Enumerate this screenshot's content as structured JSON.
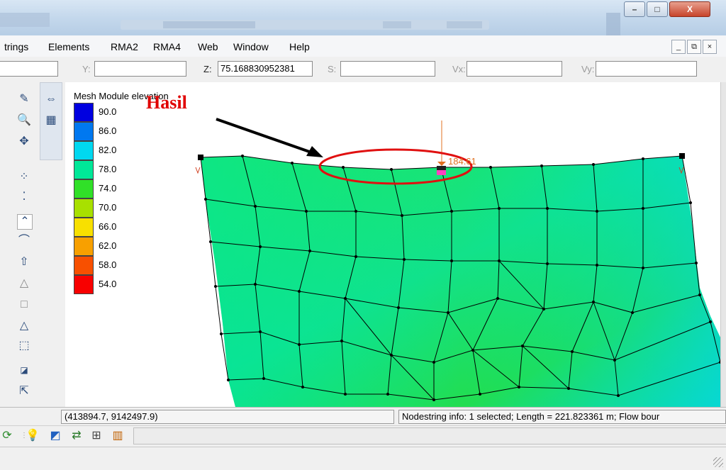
{
  "titlebar": {
    "minimize_label": "–",
    "maximize_label": "□",
    "close_label": "X"
  },
  "menu": {
    "items": [
      "trings",
      "Elements",
      "RMA2",
      "RMA4",
      "Web",
      "Window",
      "Help"
    ],
    "mdi_minimize": "_",
    "mdi_restore": "⧉",
    "mdi_close": "×"
  },
  "coords": {
    "y_label": "Y:",
    "y_value": "",
    "z_label": "Z:",
    "z_value": "75.168830952381",
    "s_label": "S:",
    "s_value": "",
    "vx_label": "Vx:",
    "vx_value": "",
    "vy_label": "Vy:",
    "vy_value": ""
  },
  "legend": {
    "title": "Mesh Module elevation",
    "entries": [
      {
        "value": "90.0",
        "color": "#0000e0"
      },
      {
        "value": "86.0",
        "color": "#0078f0"
      },
      {
        "value": "82.0",
        "color": "#00d8f0"
      },
      {
        "value": "78.0",
        "color": "#00e898"
      },
      {
        "value": "74.0",
        "color": "#30e028"
      },
      {
        "value": "70.0",
        "color": "#a8e000"
      },
      {
        "value": "66.0",
        "color": "#f8e000"
      },
      {
        "value": "62.0",
        "color": "#f8a000"
      },
      {
        "value": "58.0",
        "color": "#f85000"
      },
      {
        "value": "54.0",
        "color": "#f80000"
      }
    ]
  },
  "annotation": {
    "text": "Hasil",
    "color": "#e00000"
  },
  "node_label": "184.61",
  "status": {
    "cursor_coords": "(413894.7, 9142497.9)",
    "info": "Nodestring info: 1 selected; Length = 221.823361 m; Flow bour"
  },
  "icons": {
    "left_toolbar": [
      "select-mesh-icon",
      "measure-icon",
      "zoom-icon",
      "frame-icon",
      "rotate-icon",
      "select-node-icon",
      "create-node-icon",
      "select-nodestring-icon",
      "create-nodestring-icon",
      "select-element-icon",
      "create-triangle-icon",
      "create-quad-icon",
      "select-triangle-icon",
      "select-quad-icon",
      "merge-icon",
      "refine-icon",
      "number-icon"
    ],
    "bottom_toolbar": [
      "refresh-icon",
      "bulb-icon",
      "contour-icon",
      "model-check-icon",
      "properties-icon",
      "chart-icon"
    ]
  }
}
